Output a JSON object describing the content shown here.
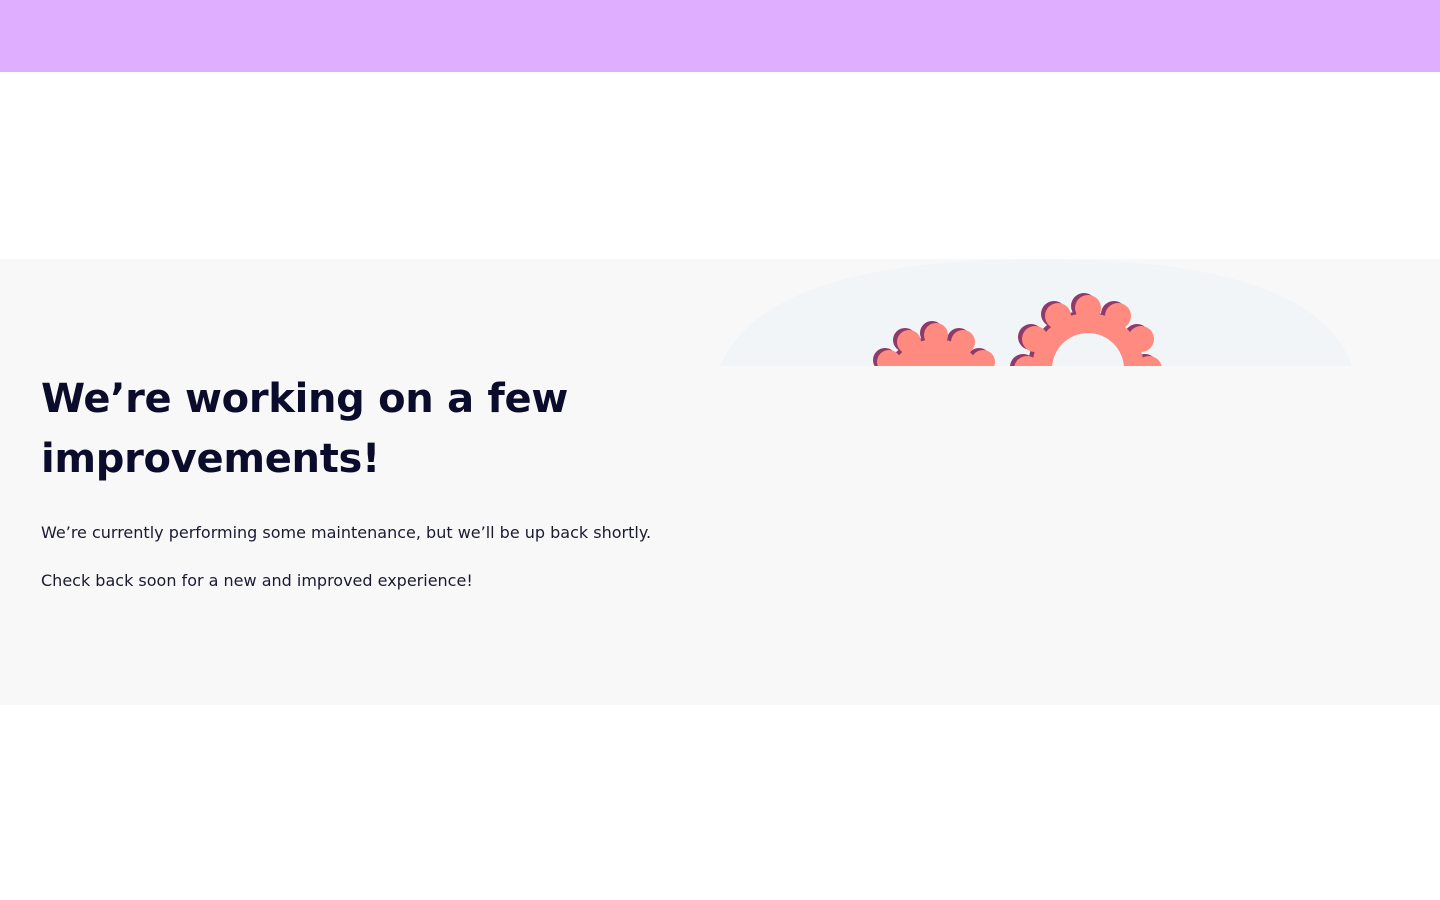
{
  "colors": {
    "top_bar": "#e0aeff",
    "section_background": "#f8f8f8",
    "illustration_backdrop": "#f2f5f8",
    "gear_fill": "#ff8a80",
    "gear_shadow": "#8e3a6b",
    "headline_text": "#0b0b2b",
    "body_text": "#1a1a33"
  },
  "maintenance": {
    "headline": "We’re working on a few improvements!",
    "message_1": "We’re currently performing some maintenance, but we’ll be up back shortly.",
    "message_2": "Check back soon for a new and improved experience!"
  },
  "illustration": {
    "icons": [
      "gear-icon",
      "gear-icon"
    ]
  }
}
